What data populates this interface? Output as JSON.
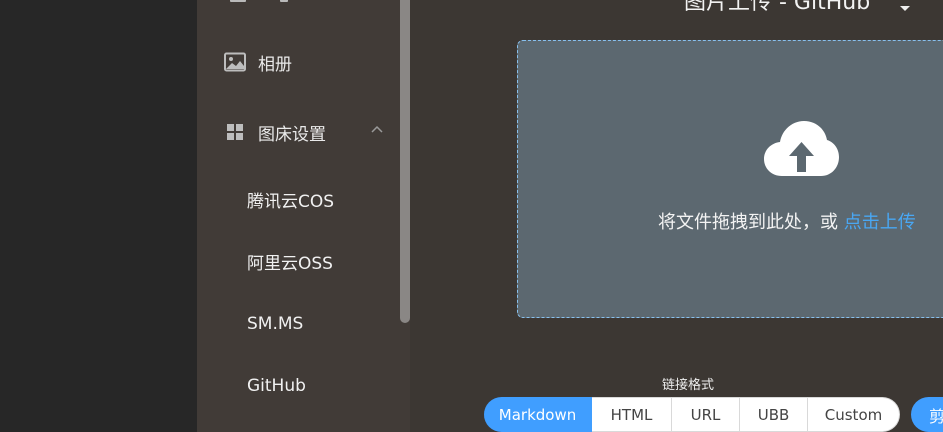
{
  "header": {
    "title": "图片上传 - GitHub",
    "title_caret": "chevron-down-icon"
  },
  "sidebar": {
    "items": [
      {
        "label": "相册",
        "icon": "image-icon"
      },
      {
        "label": "图床设置",
        "icon": "grid-icon",
        "expanded": true
      }
    ],
    "sub_items": [
      {
        "label": "腾讯云COS"
      },
      {
        "label": "阿里云OSS"
      },
      {
        "label": "SM.MS"
      },
      {
        "label": "GitHub"
      }
    ]
  },
  "upload": {
    "icon": "cloud-upload-icon",
    "text": "将文件拖拽到此处，或 ",
    "link": "点击上传"
  },
  "link_format": {
    "label": "链接格式",
    "options": [
      "Markdown",
      "HTML",
      "URL",
      "UBB",
      "Custom"
    ],
    "selected": "Markdown"
  },
  "actions": {
    "copy_label": "剪"
  },
  "colors": {
    "accent": "#409eff",
    "dropzone_bg": "#5c6870",
    "sidebar_bg": "#413b37",
    "main_bg": "#3c3733"
  }
}
